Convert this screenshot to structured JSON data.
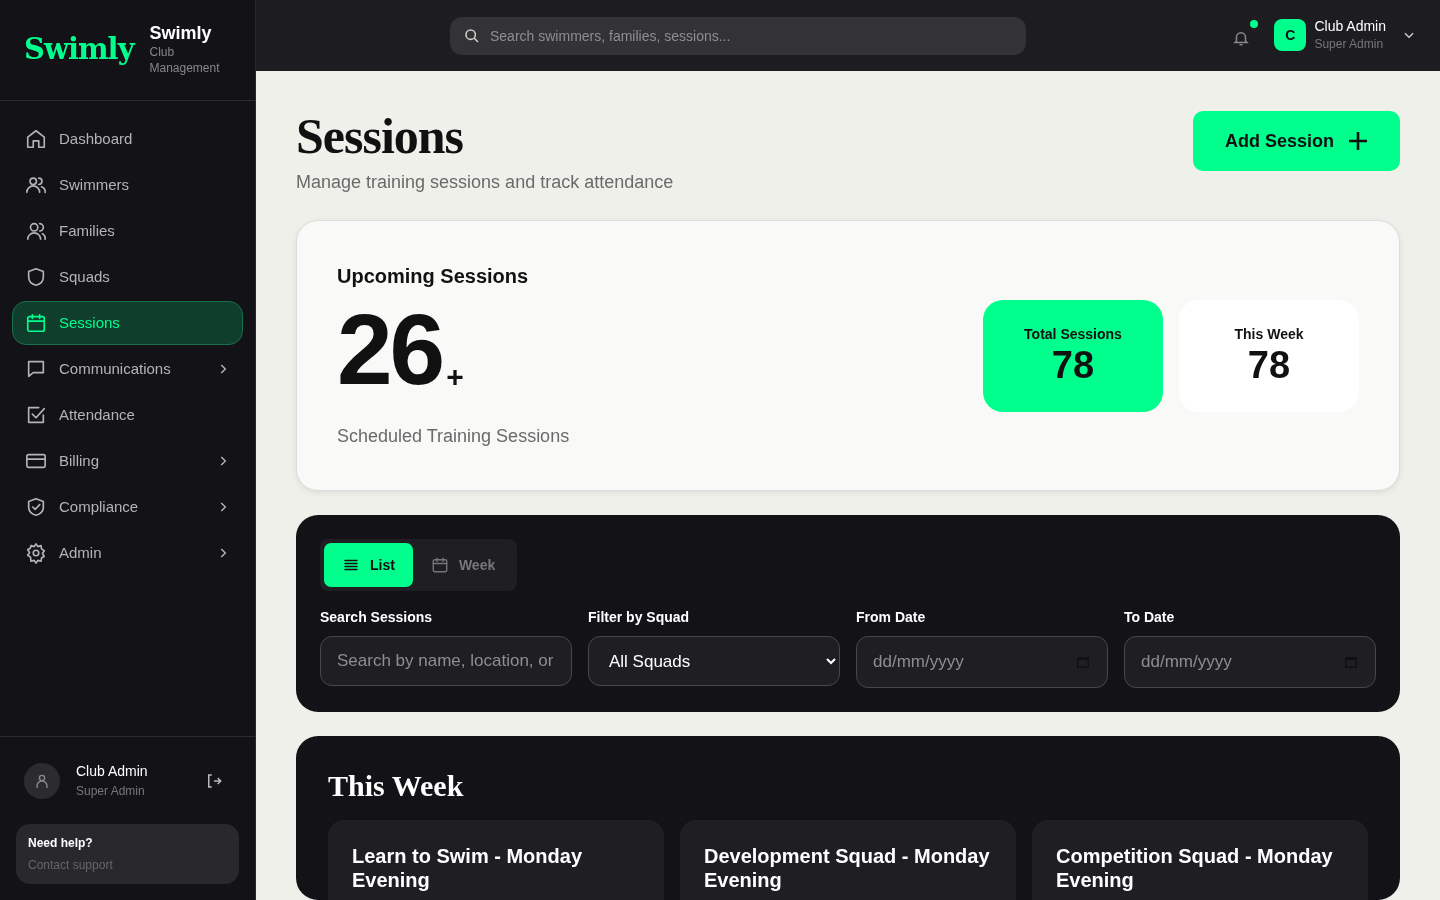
{
  "brand": {
    "logo": "Swimly",
    "name": "Swimly",
    "tagline": "Club Management"
  },
  "nav": [
    {
      "label": "Dashboard",
      "selected": false,
      "has_submenu": false
    },
    {
      "label": "Swimmers",
      "selected": false,
      "has_submenu": false
    },
    {
      "label": "Families",
      "selected": false,
      "has_submenu": false
    },
    {
      "label": "Squads",
      "selected": false,
      "has_submenu": false
    },
    {
      "label": "Sessions",
      "selected": true,
      "has_submenu": false
    },
    {
      "label": "Communications",
      "selected": false,
      "has_submenu": true
    },
    {
      "label": "Attendance",
      "selected": false,
      "has_submenu": false
    },
    {
      "label": "Billing",
      "selected": false,
      "has_submenu": true
    },
    {
      "label": "Compliance",
      "selected": false,
      "has_submenu": true
    },
    {
      "label": "Admin",
      "selected": false,
      "has_submenu": true
    }
  ],
  "sidebar_user": {
    "name": "Club Admin",
    "role": "Super Admin"
  },
  "help": {
    "title": "Need help?",
    "link": "Contact support"
  },
  "topbar": {
    "search_placeholder": "Search swimmers, families, sessions...",
    "notification_unread": true,
    "avatar_letter": "C",
    "user_name": "Club Admin",
    "user_role": "Super Admin"
  },
  "page": {
    "title": "Sessions",
    "subtitle": "Manage training sessions and track attendance",
    "add_button": "Add Session"
  },
  "summary": {
    "heading": "Upcoming Sessions",
    "count": "26",
    "suffix": "+",
    "caption": "Scheduled Training Sessions",
    "stats": [
      {
        "label": "Total Sessions",
        "value": "78",
        "highlighted": true
      },
      {
        "label": "This Week",
        "value": "78",
        "highlighted": false
      }
    ]
  },
  "view_toggle": [
    {
      "label": "List",
      "selected": true
    },
    {
      "label": "Week",
      "selected": false
    }
  ],
  "filters": [
    {
      "kind": "text",
      "label": "Search Sessions",
      "placeholder": "Search by name, location, or"
    },
    {
      "kind": "select",
      "label": "Filter by Squad",
      "value": "All Squads"
    },
    {
      "kind": "date",
      "label": "From Date",
      "placeholder": "dd/mm/yyyy"
    },
    {
      "kind": "date",
      "label": "To Date",
      "placeholder": "dd/mm/yyyy"
    }
  ],
  "this_week": {
    "title": "This Week",
    "sessions": [
      {
        "title": "Learn to Swim - Monday Evening"
      },
      {
        "title": "Development Squad - Monday Evening"
      },
      {
        "title": "Competition Squad - Monday Evening"
      }
    ]
  }
}
